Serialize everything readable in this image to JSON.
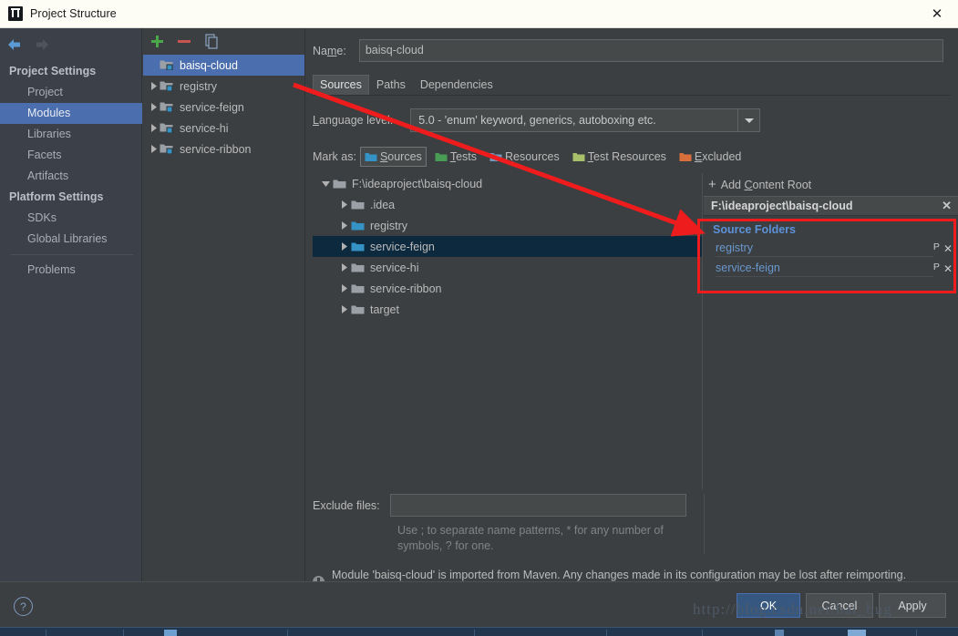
{
  "window": {
    "title": "Project Structure",
    "icon": "intellij-idea-icon",
    "close_label": "✕"
  },
  "sidebar": {
    "nav": {
      "back_icon": "back-arrow-icon",
      "forward_icon": "forward-arrow-icon"
    },
    "items": [
      {
        "label": "Project Settings",
        "type": "group",
        "selected": false
      },
      {
        "label": "Project",
        "type": "item",
        "selected": false
      },
      {
        "label": "Modules",
        "type": "item",
        "selected": true
      },
      {
        "label": "Libraries",
        "type": "item",
        "selected": false
      },
      {
        "label": "Facets",
        "type": "item",
        "selected": false
      },
      {
        "label": "Artifacts",
        "type": "item",
        "selected": false
      },
      {
        "label": "Platform Settings",
        "type": "group",
        "selected": false
      },
      {
        "label": "SDKs",
        "type": "item",
        "selected": false
      },
      {
        "label": "Global Libraries",
        "type": "item",
        "selected": false
      },
      {
        "label": "Problems",
        "type": "item",
        "selected": false
      }
    ]
  },
  "modules_panel": {
    "toolbar": {
      "add_icon": "plus-icon",
      "remove_icon": "minus-icon",
      "copy_icon": "copy-icon"
    },
    "modules": [
      {
        "label": "baisq-cloud",
        "selected": true,
        "expandable": false
      },
      {
        "label": "registry",
        "selected": false,
        "expandable": true
      },
      {
        "label": "service-feign",
        "selected": false,
        "expandable": true
      },
      {
        "label": "service-hi",
        "selected": false,
        "expandable": true
      },
      {
        "label": "service-ribbon",
        "selected": false,
        "expandable": true
      }
    ]
  },
  "main": {
    "name_label": "Name:",
    "name_value": "baisq-cloud",
    "tabs": [
      {
        "label": "Sources",
        "active": true
      },
      {
        "label": "Paths",
        "active": false
      },
      {
        "label": "Dependencies",
        "active": false
      }
    ],
    "language_level_label": "Language level:",
    "language_level_value": "5.0 - 'enum' keyword, generics, autoboxing etc.",
    "mark_as_label": "Mark as:",
    "mark_as_options": [
      {
        "label": "Sources",
        "color": "#3592c4",
        "active": true
      },
      {
        "label": "Tests",
        "color": "#499c54",
        "active": false
      },
      {
        "label": "Resources",
        "color": "#6e9bbd",
        "active": false
      },
      {
        "label": "Test Resources",
        "color": "#a8c06a",
        "active": false
      },
      {
        "label": "Excluded",
        "color": "#d9703b",
        "active": false
      }
    ],
    "tree": [
      {
        "label": "F:\\ideaproject\\baisq-cloud",
        "depth": 0,
        "expanded": true,
        "kind": "plain",
        "selected": false
      },
      {
        "label": ".idea",
        "depth": 1,
        "expanded": false,
        "kind": "plain",
        "selected": false
      },
      {
        "label": "registry",
        "depth": 1,
        "expanded": false,
        "kind": "source",
        "selected": false
      },
      {
        "label": "service-feign",
        "depth": 1,
        "expanded": false,
        "kind": "source",
        "selected": true
      },
      {
        "label": "service-hi",
        "depth": 1,
        "expanded": false,
        "kind": "plain",
        "selected": false
      },
      {
        "label": "service-ribbon",
        "depth": 1,
        "expanded": false,
        "kind": "plain",
        "selected": false
      },
      {
        "label": "target",
        "depth": 1,
        "expanded": false,
        "kind": "plain",
        "selected": false
      }
    ],
    "right_column": {
      "add_content_root": "Add Content Root",
      "add_plus": "+",
      "content_root_path": "F:\\ideaproject\\baisq-cloud",
      "content_root_close": "✕",
      "source_folders_title": "Source Folders",
      "source_folders": [
        {
          "label": "registry",
          "prefix_icon": "package-prefix-icon",
          "remove_icon": "✕"
        },
        {
          "label": "service-feign",
          "prefix_icon": "package-prefix-icon",
          "remove_icon": "✕"
        }
      ]
    },
    "exclude_label": "Exclude files:",
    "exclude_value": "",
    "exclude_hint": "Use ; to separate name patterns, * for any number of symbols, ? for one.",
    "note_text": "Module 'baisq-cloud' is imported from Maven. Any changes made in its configuration may be lost after reimporting."
  },
  "footer": {
    "help_label": "?",
    "ok_label": "OK",
    "cancel_label": "Cancel",
    "apply_label": "Apply"
  },
  "annotations": {
    "watermark": "http://blog.csdn.net/bai_bug",
    "arrow_color": "#ee1c1c",
    "box_color": "#ee1c1c"
  }
}
